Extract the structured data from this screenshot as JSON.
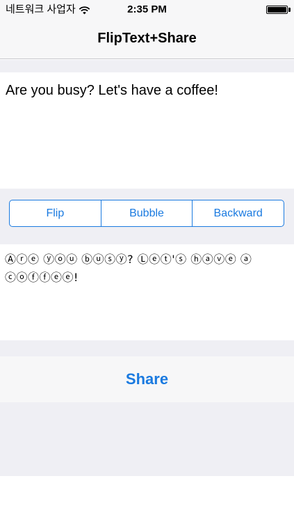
{
  "status_bar": {
    "carrier": "네트워크 사업자",
    "time": "2:35 PM"
  },
  "nav": {
    "title": "FlipText+Share"
  },
  "input": {
    "value": "Are you busy? Let's have a coffee!"
  },
  "segmented_control": {
    "segments": [
      {
        "label": "Flip"
      },
      {
        "label": "Bubble"
      },
      {
        "label": "Backward"
      }
    ]
  },
  "output": {
    "value": "Ⓐⓡⓔ ⓨⓞⓤ ⓑⓤⓢⓨ? Ⓛⓔⓣ'ⓢ ⓗⓐⓥⓔ ⓐ ⓒⓞⓕⓕⓔⓔ!"
  },
  "share": {
    "label": "Share"
  },
  "colors": {
    "accent": "#1a7ae0",
    "band": "#efeff4",
    "bar": "#f7f7f8"
  }
}
